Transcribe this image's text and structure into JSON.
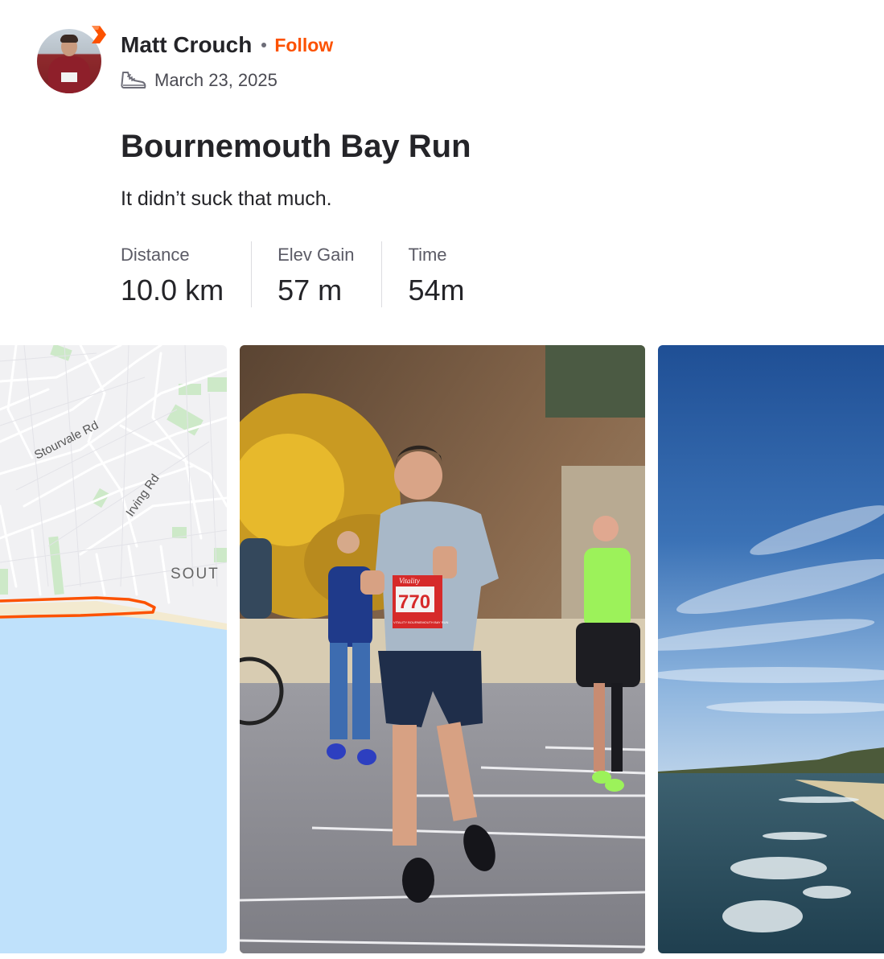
{
  "athlete": {
    "name": "Matt Crouch",
    "follow_label": "Follow",
    "activity_date": "March 23, 2025",
    "activity_icon": "running-shoe-icon"
  },
  "activity": {
    "title": "Bournemouth Bay Run",
    "description": "It didn’t suck that much."
  },
  "stats": [
    {
      "label": "Distance",
      "value": "10.0 km"
    },
    {
      "label": "Elev Gain",
      "value": "57 m"
    },
    {
      "label": "Time",
      "value": "54m"
    }
  ],
  "map": {
    "street_labels": [
      "Stourvale Rd",
      "Irving Rd",
      "SOUT"
    ],
    "route_color": "#fc5200",
    "water_color": "#bfe1fb"
  },
  "colors": {
    "accent": "#fc5200",
    "text": "#242428",
    "muted": "#5b5b66"
  },
  "photos": [
    {
      "bib_brand": "Vitality",
      "bib_number": "770",
      "bib_caption": "VITALITY BOURNEMOUTH BAY RUN"
    },
    {}
  ]
}
